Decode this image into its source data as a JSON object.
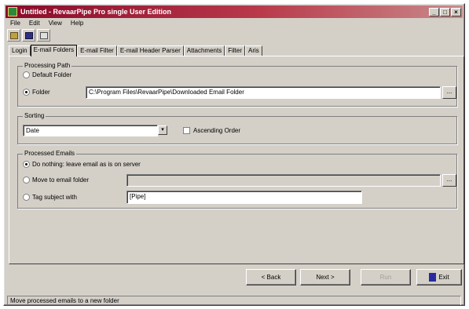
{
  "window": {
    "title": "Untitled - RevaarPipe Pro single User Edition",
    "minimize_glyph": "_",
    "maximize_glyph": "□",
    "close_glyph": "×"
  },
  "menu": {
    "items": [
      "File",
      "Edit",
      "View",
      "Help"
    ]
  },
  "toolbar": {
    "tools": [
      {
        "icon": "open-icon",
        "color": "#c0a040"
      },
      {
        "icon": "save-icon",
        "color": "#303080"
      },
      {
        "icon": "run-icon",
        "color": "#505050"
      }
    ]
  },
  "tabs": {
    "items": [
      "Login",
      "E-mail Folders",
      "E-mail Filter",
      "E-mail Header Parser",
      "Attachments",
      "Filter",
      "Aris"
    ],
    "active_index": 1
  },
  "target_folder": {
    "title": "Processing Path",
    "default_label": "Default Folder",
    "folder_label": "Folder",
    "folder_value": "C:\\Program Files\\RevaarPipe\\Downloaded Email Folder",
    "selected": "folder",
    "browse_label": "..."
  },
  "sorting": {
    "title": "Sorting",
    "value": "Date",
    "arrow_glyph": "▾",
    "ascending_label": "Ascending Order",
    "ascending_checked": false
  },
  "processed_emails": {
    "title": "Processed Emails",
    "options": [
      {
        "label": "Do nothing: leave email as is on server",
        "selected": true
      },
      {
        "label": "Move to email folder",
        "selected": false
      },
      {
        "label": "Tag subject with",
        "selected": false
      }
    ],
    "move_folder_value": "",
    "tag_value": "[Pipe]",
    "browse_label": "..."
  },
  "buttons": {
    "back": "< Back",
    "next": "Next >",
    "finish": "Run",
    "exit": "Exit"
  },
  "status": {
    "text": "Move processed emails to a new folder"
  }
}
